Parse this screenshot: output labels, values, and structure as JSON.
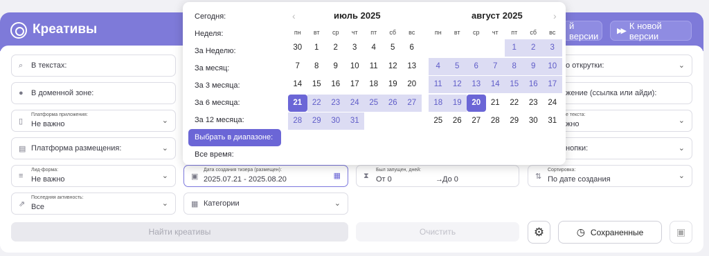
{
  "header": {
    "title": "Креативы",
    "btn_old": "й версии",
    "btn_new": "К новой версии"
  },
  "filters": {
    "text_search": "В текстах:",
    "domain_zone": "В доменной зоне:",
    "app_platform_label": "Платформа приложения:",
    "app_platform_value": "Не важно",
    "placement_platform": "Платформа размещения:",
    "lead_form_label": "Лид-форма:",
    "lead_form_value": "Не важно",
    "last_activity_label": "Последняя активность:",
    "last_activity_value": "Все",
    "date_label": "Дата создания тизера (размещен):",
    "date_value": "2025.07.21 - 2025.08.20",
    "categories": "Категории",
    "launched_label": "Был запущен, дней:",
    "from": "От  0",
    "to": "До  0",
    "rotation": "о открутки:",
    "placement_link": "жение (ссылка или айди):",
    "text_type_label": "е текста:",
    "text_type_value": "жно",
    "buttons": "нопки:",
    "sort_label": "Сортировка:",
    "sort_value": "По дате создания"
  },
  "actions": {
    "find": "Найти креативы",
    "clear": "Очистить",
    "saved": "Сохраненные"
  },
  "presets": [
    "Сегодня:",
    "Неделя:",
    "За Неделю:",
    "За месяц:",
    "За 3 месяца:",
    "За 6 месяца:",
    "За 12 месяца:",
    "Выбрать в диапазоне:",
    "Все время:"
  ],
  "selected_preset": 7,
  "calendar": {
    "weekdays": [
      "пн",
      "вт",
      "ср",
      "чт",
      "пт",
      "сб",
      "вс"
    ],
    "prev_icon": "‹",
    "next_icon": "›",
    "months": [
      {
        "title": "июль 2025",
        "rows": [
          [
            "30",
            "1",
            "2",
            "3",
            "4",
            "5",
            "6"
          ],
          [
            "7",
            "8",
            "9",
            "10",
            "11",
            "12",
            "13"
          ],
          [
            "14",
            "15",
            "16",
            "17",
            "18",
            "19",
            "20"
          ],
          [
            "21",
            "22",
            "23",
            "24",
            "25",
            "26",
            "27"
          ],
          [
            "28",
            "29",
            "30",
            "31",
            "",
            "",
            ""
          ]
        ]
      },
      {
        "title": "август 2025",
        "rows": [
          [
            "",
            "",
            "",
            "",
            "1",
            "2",
            "3"
          ],
          [
            "4",
            "5",
            "6",
            "7",
            "8",
            "9",
            "10"
          ],
          [
            "11",
            "12",
            "13",
            "14",
            "15",
            "16",
            "17"
          ],
          [
            "18",
            "19",
            "20",
            "21",
            "22",
            "23",
            "24"
          ],
          [
            "25",
            "26",
            "27",
            "28",
            "29",
            "30",
            "31"
          ]
        ]
      }
    ],
    "range_start": "2025-07-21",
    "range_end": "2025-08-20"
  },
  "colors": {
    "accent": "#6b66d6",
    "header": "#7e7ad9",
    "range": "#dcdcf3"
  }
}
